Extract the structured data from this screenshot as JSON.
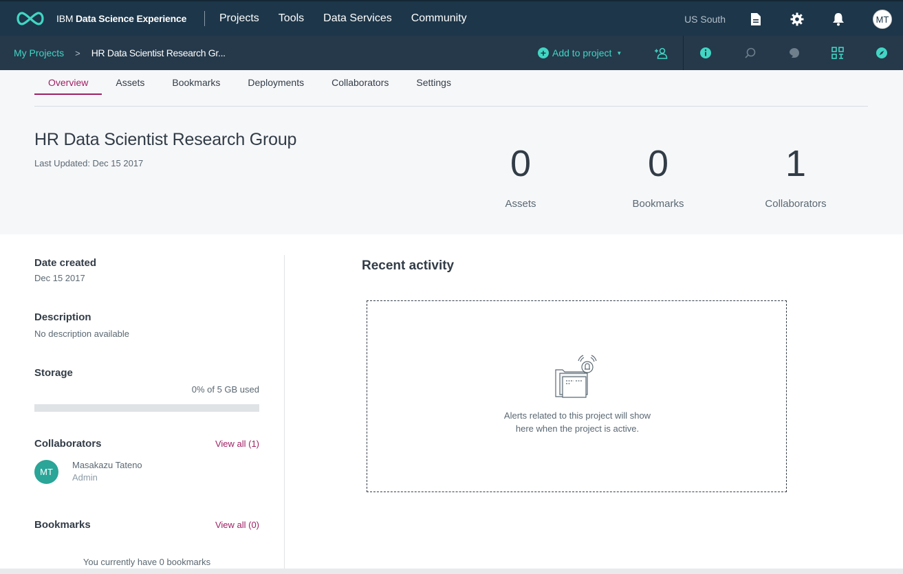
{
  "app": {
    "brand_prefix": "IBM",
    "brand_name": "Data Science Experience",
    "nav": [
      "Projects",
      "Tools",
      "Data Services",
      "Community"
    ],
    "region": "US South",
    "user_initials": "MT"
  },
  "breadcrumb": {
    "root": "My Projects",
    "separator": ">",
    "current": "HR Data Scientist Research Gr..."
  },
  "toolbar": {
    "add_to_project": "Add to project"
  },
  "tabs": [
    "Overview",
    "Assets",
    "Bookmarks",
    "Deployments",
    "Collaborators",
    "Settings"
  ],
  "project": {
    "title": "HR Data Scientist Research Group",
    "last_updated": "Last Updated: Dec 15 2017"
  },
  "stats": [
    {
      "value": "0",
      "label": "Assets"
    },
    {
      "value": "0",
      "label": "Bookmarks"
    },
    {
      "value": "1",
      "label": "Collaborators"
    }
  ],
  "details": {
    "date_created_label": "Date created",
    "date_created": "Dec 15 2017",
    "description_label": "Description",
    "description": "No description available",
    "storage_label": "Storage",
    "storage_used": "0% of 5 GB used",
    "storage_fraction": 0,
    "collaborators_label": "Collaborators",
    "collaborators_view_all": "View all (1)",
    "collaborator": {
      "initials": "MT",
      "name": "Masakazu Tateno",
      "role": "Admin"
    },
    "bookmarks_label": "Bookmarks",
    "bookmarks_view_all": "View all (0)",
    "bookmarks_empty": "You currently have 0 bookmarks"
  },
  "activity": {
    "title": "Recent activity",
    "line1": "Alerts related to this project will show",
    "line2": "here when the project is active."
  },
  "colors": {
    "nav_bg": "#1d3649",
    "accent_teal": "#41d6c3",
    "accent_magenta": "#9e1f63"
  }
}
